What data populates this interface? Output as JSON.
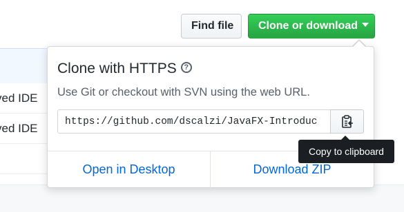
{
  "toolbar": {
    "find_file_label": "Find file",
    "clone_label": "Clone or download"
  },
  "background": {
    "row1_text": "ved IDE",
    "row2_text": "ved IDE"
  },
  "clone_panel": {
    "title": "Clone with HTTPS",
    "help_glyph": "?",
    "description": "Use Git or checkout with SVN using the web URL.",
    "url_value": "https://github.com/dscalzi/JavaFX-Introduc",
    "copy_icon": "clipboard-icon",
    "open_desktop_label": "Open in Desktop",
    "download_zip_label": "Download ZIP"
  },
  "tooltip": {
    "text": "Copy to clipboard"
  },
  "colors": {
    "accent_green": "#28a745",
    "link_blue": "#0366d6",
    "tooltip_bg": "#1b1f23"
  }
}
